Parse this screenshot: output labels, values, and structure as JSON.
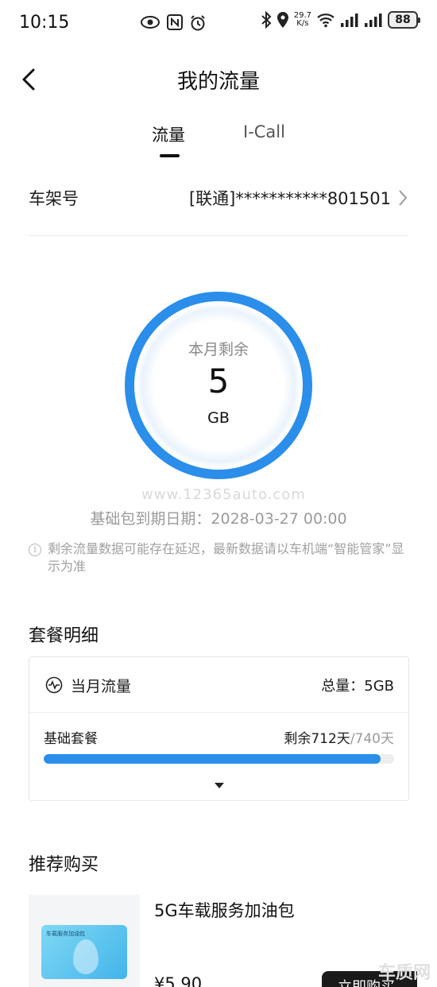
{
  "status_bar": {
    "time": "10:15",
    "net_speed_value": "29.7",
    "net_speed_unit": "K/s",
    "battery": "88"
  },
  "header": {
    "title": "我的流量"
  },
  "tabs": [
    {
      "label": "流量",
      "active": true
    },
    {
      "label": "I-Call",
      "active": false
    }
  ],
  "vin": {
    "label": "车架号",
    "value": "[联通]***********801501"
  },
  "usage_ring": {
    "label": "本月剩余",
    "value": "5",
    "unit": "GB",
    "fill_fraction": 1.0,
    "ring_color": "#2a8eea"
  },
  "watermark": "www.12365auto.com",
  "expiry_text": "基础包到期日期：2028-03-27 00:00",
  "notice_text": "剩余流量数据可能存在延迟，最新数据请以车机端“智能管家”显示为准",
  "plan_section": {
    "title": "套餐明细",
    "month_label": "当月流量",
    "total_text": "总量：5GB",
    "base_label": "基础套餐",
    "remain_text": "剩余712天",
    "total_days_text": "/740天",
    "progress_fraction": 0.962
  },
  "recommend_section": {
    "title": "推荐购买",
    "product_card_text": "车载服务加油包",
    "product_name": "5G车载服务加油包",
    "price": "¥5.90",
    "buy_label": "立即购买"
  },
  "corner_logo": "车质网",
  "colors": {
    "accent": "#2a8eea",
    "muted_text": "#9a9a9a"
  }
}
